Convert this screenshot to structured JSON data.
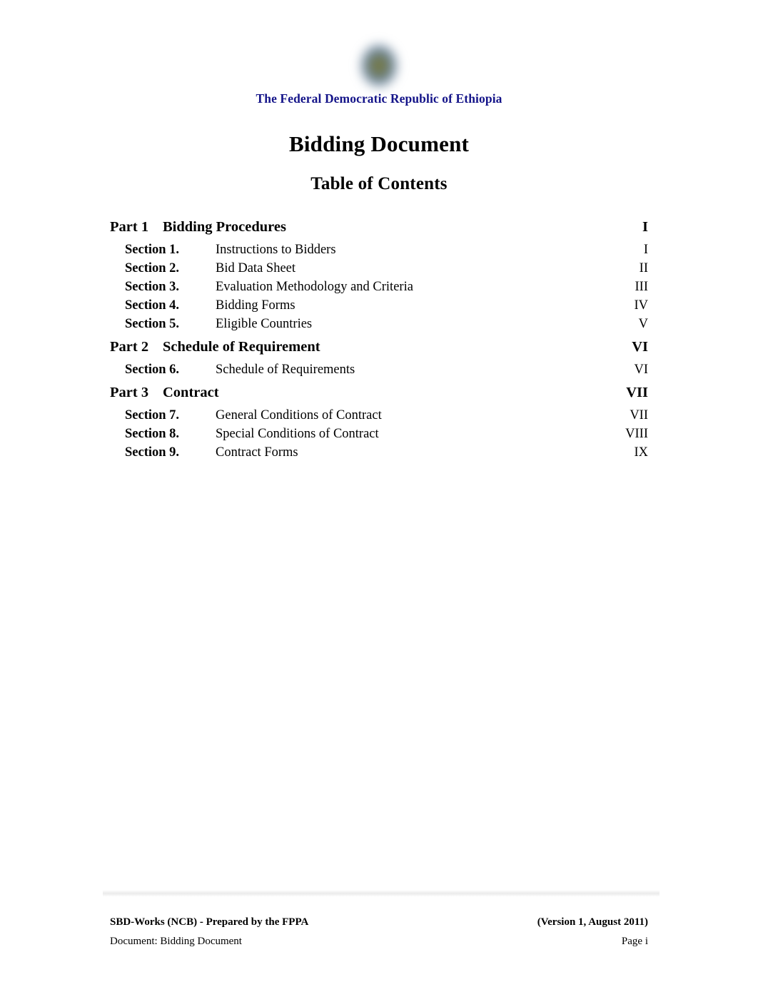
{
  "header": {
    "emblem_icon": "ethiopia-emblem-icon",
    "organization": "The Federal Democratic Republic of Ethiopia",
    "document_title": "Bidding Document",
    "contents_title": "Table of Contents",
    "organization_color": "#141489"
  },
  "toc": {
    "parts": [
      {
        "label": "Part 1",
        "name": "Bidding Procedures",
        "page": "I",
        "sections": [
          {
            "label": "Section 1.",
            "name": "Instructions to Bidders",
            "page": "I"
          },
          {
            "label": "Section 2.",
            "name": "Bid Data Sheet",
            "page": "II"
          },
          {
            "label": "Section 3.",
            "name": "Evaluation Methodology and Criteria",
            "page": "III"
          },
          {
            "label": "Section 4.",
            "name": "Bidding Forms",
            "page": "IV"
          },
          {
            "label": "Section 5.",
            "name": "Eligible Countries",
            "page": "V"
          }
        ]
      },
      {
        "label": "Part 2",
        "name": "Schedule of Requirement",
        "page": "VI",
        "sections": [
          {
            "label": "Section 6.",
            "name": "Schedule of Requirements",
            "page": "VI"
          }
        ]
      },
      {
        "label": "Part 3",
        "name": "Contract",
        "page": "VII",
        "sections": [
          {
            "label": "Section 7.",
            "name": "General Conditions of Contract",
            "page": "VII"
          },
          {
            "label": "Section 8.",
            "name": "Special Conditions of Contract",
            "page": "VIII"
          },
          {
            "label": "Section 9.",
            "name": "Contract Forms",
            "page": "IX"
          }
        ]
      }
    ]
  },
  "footer": {
    "prepared_by": "SBD-Works (NCB) - Prepared by the FPPA",
    "version": "(Version 1, August 2011)",
    "document_name": "Document: Bidding Document",
    "page_number": "Page i"
  }
}
